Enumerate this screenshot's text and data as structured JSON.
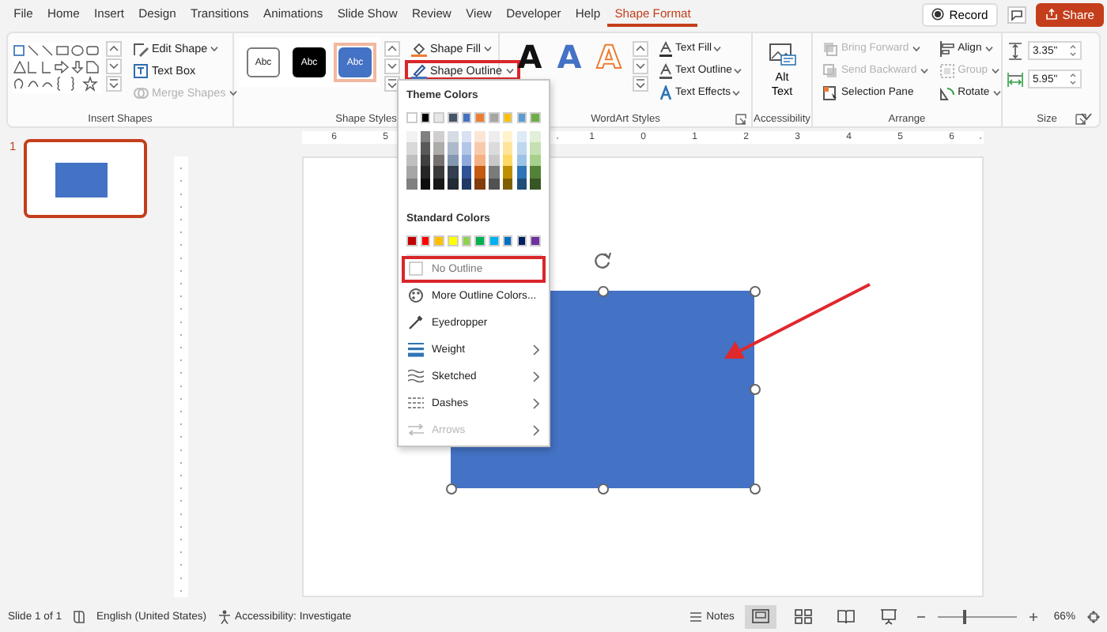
{
  "ribbon_tabs": [
    {
      "label": "File",
      "selected": false
    },
    {
      "label": "Home",
      "selected": false
    },
    {
      "label": "Insert",
      "selected": false
    },
    {
      "label": "Design",
      "selected": false
    },
    {
      "label": "Transitions",
      "selected": false
    },
    {
      "label": "Animations",
      "selected": false
    },
    {
      "label": "Slide Show",
      "selected": false
    },
    {
      "label": "Review",
      "selected": false
    },
    {
      "label": "View",
      "selected": false
    },
    {
      "label": "Developer",
      "selected": false
    },
    {
      "label": "Help",
      "selected": false
    },
    {
      "label": "Shape Format",
      "selected": true
    }
  ],
  "header_buttons": {
    "record": "Record",
    "share": "Share"
  },
  "ribbon": {
    "groups": [
      {
        "kind": "insert_shapes",
        "label": "Insert Shapes",
        "buttons": [
          {
            "kind": "edit_shape",
            "label": "Edit Shape",
            "dropdown": true,
            "disabled": false
          },
          {
            "kind": "text_box",
            "label": "Text Box",
            "dropdown": false,
            "disabled": false
          },
          {
            "kind": "merge",
            "label": "Merge Shapes",
            "dropdown": true,
            "disabled": true
          }
        ]
      },
      {
        "kind": "shape_styles",
        "label": "Shape Styles",
        "presets": [
          {
            "kind": "outline",
            "label": "Abc",
            "selected": false
          },
          {
            "kind": "dark",
            "label": "Abc",
            "selected": false
          },
          {
            "kind": "blue",
            "label": "Abc",
            "selected": true
          }
        ],
        "buttons": [
          {
            "kind": "shape_fill",
            "label": "Shape Fill",
            "dropdown": true,
            "highlighted": false
          },
          {
            "kind": "shape_outline",
            "label": "Shape Outline",
            "dropdown": true,
            "highlighted": true
          }
        ]
      },
      {
        "kind": "wordart",
        "label": "WordArt Styles",
        "presets": [
          {
            "kind": "solid",
            "label": "A"
          },
          {
            "kind": "blue_outline",
            "label": "A"
          },
          {
            "kind": "orange_outline",
            "label": "A"
          }
        ],
        "buttons": [
          {
            "kind": "text_fill",
            "label": "Text Fill",
            "dropdown": true
          },
          {
            "kind": "text_outline",
            "label": "Text Outline",
            "dropdown": true
          },
          {
            "kind": "text_effects",
            "label": "Text Effects",
            "dropdown": true
          }
        ]
      },
      {
        "kind": "accessibility",
        "label": "Accessibility",
        "buttons": [
          {
            "kind": "alt_text",
            "label": "Alt Text"
          }
        ]
      },
      {
        "kind": "arrange",
        "label": "Arrange",
        "buttons": [
          {
            "kind": "bring_forward",
            "label": "Bring Forward",
            "dropdown": true,
            "disabled": true
          },
          {
            "kind": "send_backward",
            "label": "Send Backward",
            "dropdown": true,
            "disabled": true
          },
          {
            "kind": "selection_pane",
            "label": "Selection Pane",
            "dropdown": false,
            "disabled": false
          },
          {
            "kind": "align",
            "label": "Align",
            "dropdown": true,
            "disabled": false
          },
          {
            "kind": "group",
            "label": "Group",
            "dropdown": true,
            "disabled": true
          },
          {
            "kind": "rotate",
            "label": "Rotate",
            "dropdown": true,
            "disabled": false
          }
        ]
      },
      {
        "kind": "size",
        "label": "Size",
        "fields": [
          {
            "kind": "height",
            "value": "3.35\""
          },
          {
            "kind": "width",
            "value": "5.95\""
          }
        ]
      }
    ]
  },
  "outline_menu": {
    "theme_heading": "Theme Colors",
    "theme_colors": [
      {
        "color": "#ffffff",
        "shades": [
          {
            "color": "#f2f2f2"
          },
          {
            "color": "#d9d9d9"
          },
          {
            "color": "#bfbfbf"
          },
          {
            "color": "#a6a6a6"
          },
          {
            "color": "#808080"
          }
        ]
      },
      {
        "color": "#000000",
        "shades": [
          {
            "color": "#808080"
          },
          {
            "color": "#595959"
          },
          {
            "color": "#404040"
          },
          {
            "color": "#262626"
          },
          {
            "color": "#0d0d0d"
          }
        ]
      },
      {
        "color": "#e7e6e6",
        "shades": [
          {
            "color": "#d0cece"
          },
          {
            "color": "#aeabab"
          },
          {
            "color": "#757171"
          },
          {
            "color": "#3a3838"
          },
          {
            "color": "#171616"
          }
        ]
      },
      {
        "color": "#44546a",
        "shades": [
          {
            "color": "#d6dce4"
          },
          {
            "color": "#adb9ca"
          },
          {
            "color": "#8497b0"
          },
          {
            "color": "#333f4f"
          },
          {
            "color": "#222a35"
          }
        ]
      },
      {
        "color": "#4472c4",
        "shades": [
          {
            "color": "#d9e2f3"
          },
          {
            "color": "#b4c6e7"
          },
          {
            "color": "#8eaadb"
          },
          {
            "color": "#2f5496"
          },
          {
            "color": "#1f3864"
          }
        ]
      },
      {
        "color": "#ed7d31",
        "shades": [
          {
            "color": "#fbe5d5"
          },
          {
            "color": "#f7caac"
          },
          {
            "color": "#f4b183"
          },
          {
            "color": "#c55a11"
          },
          {
            "color": "#833c0b"
          }
        ]
      },
      {
        "color": "#a5a5a5",
        "shades": [
          {
            "color": "#ededed"
          },
          {
            "color": "#dbdbdb"
          },
          {
            "color": "#c9c9c9"
          },
          {
            "color": "#7b7b7b"
          },
          {
            "color": "#525252"
          }
        ]
      },
      {
        "color": "#ffc000",
        "shades": [
          {
            "color": "#fff2cc"
          },
          {
            "color": "#ffe599"
          },
          {
            "color": "#ffd966"
          },
          {
            "color": "#bf8f00"
          },
          {
            "color": "#7f6000"
          }
        ]
      },
      {
        "color": "#5b9bd5",
        "shades": [
          {
            "color": "#deebf6"
          },
          {
            "color": "#bdd7ee"
          },
          {
            "color": "#9cc3e5"
          },
          {
            "color": "#2e75b5"
          },
          {
            "color": "#1f4e79"
          }
        ]
      },
      {
        "color": "#70ad47",
        "shades": [
          {
            "color": "#e2efd9"
          },
          {
            "color": "#c5e0b3"
          },
          {
            "color": "#a8d08d"
          },
          {
            "color": "#538135"
          },
          {
            "color": "#375623"
          }
        ]
      }
    ],
    "standard_heading": "Standard Colors",
    "standard_colors": [
      {
        "color": "#c00000"
      },
      {
        "color": "#ff0000"
      },
      {
        "color": "#ffc000"
      },
      {
        "color": "#ffff00"
      },
      {
        "color": "#92d050"
      },
      {
        "color": "#00b050"
      },
      {
        "color": "#00b0f0"
      },
      {
        "color": "#0070c0"
      },
      {
        "color": "#002060"
      },
      {
        "color": "#7030a0"
      }
    ],
    "items": [
      {
        "kind": "no_outline",
        "label": "No Outline",
        "submenu": false,
        "disabled": false,
        "highlighted": true
      },
      {
        "kind": "more_colors",
        "label": "More Outline Colors...",
        "submenu": false,
        "disabled": false,
        "highlighted": false
      },
      {
        "kind": "eyedropper",
        "label": "Eyedropper",
        "submenu": false,
        "disabled": false,
        "highlighted": false
      },
      {
        "kind": "weight",
        "label": "Weight",
        "submenu": true,
        "disabled": false,
        "highlighted": false
      },
      {
        "kind": "sketched",
        "label": "Sketched",
        "submenu": true,
        "disabled": false,
        "highlighted": false
      },
      {
        "kind": "dashes",
        "label": "Dashes",
        "submenu": true,
        "disabled": false,
        "highlighted": false
      },
      {
        "kind": "arrows",
        "label": "Arrows",
        "submenu": true,
        "disabled": true,
        "highlighted": false
      }
    ]
  },
  "slides": [
    {
      "number": "1",
      "selected": true
    }
  ],
  "ruler": {
    "left_numbers": [
      "6",
      "5"
    ],
    "right_numbers": [
      "1",
      "0",
      "1",
      "2",
      "3",
      "4",
      "5",
      "6"
    ]
  },
  "canvas": {
    "shape": {
      "selected": true
    }
  },
  "status_bar": {
    "slide": "Slide 1 of 1",
    "language": "English (United States)",
    "accessibility": "Accessibility: Investigate",
    "notes": "Notes",
    "views": [
      {
        "kind": "normal",
        "selected": true
      },
      {
        "kind": "sorter",
        "selected": false
      },
      {
        "kind": "reading",
        "selected": false
      },
      {
        "kind": "slideshow",
        "selected": false
      }
    ],
    "zoom": {
      "level": 0.34
    },
    "zoom_label": "66%"
  }
}
